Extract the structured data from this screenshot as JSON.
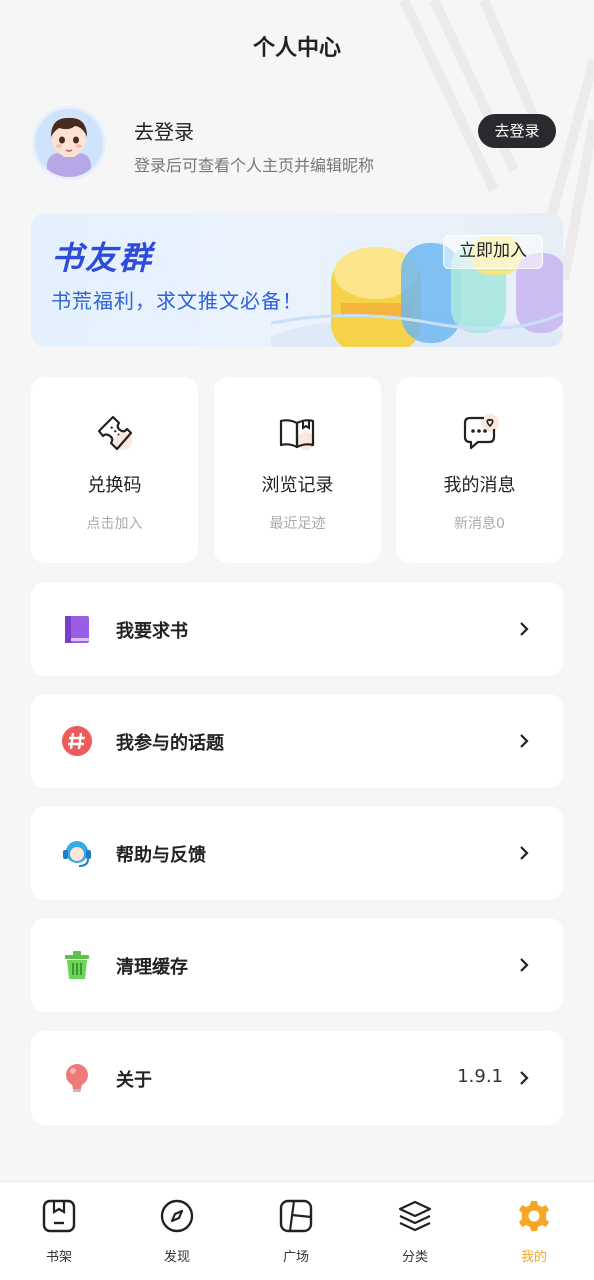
{
  "header": {
    "title": "个人中心"
  },
  "profile": {
    "title": "去登录",
    "subtitle": "登录后可查看个人主页并编辑昵称",
    "button": "去登录"
  },
  "banner": {
    "title": "书友群",
    "subtitle": "书荒福利，求文推文必备！",
    "button": "立即加入"
  },
  "cards": [
    {
      "title": "兑换码",
      "subtitle": "点击加入",
      "icon": "ticket-icon"
    },
    {
      "title": "浏览记录",
      "subtitle": "最近足迹",
      "icon": "book-open-icon"
    },
    {
      "title": "我的消息",
      "subtitle": "新消息0",
      "icon": "message-icon"
    }
  ],
  "menu": [
    {
      "label": "我要求书",
      "icon": "book-icon",
      "value": ""
    },
    {
      "label": "我参与的话题",
      "icon": "hashtag-icon",
      "value": ""
    },
    {
      "label": "帮助与反馈",
      "icon": "headset-icon",
      "value": ""
    },
    {
      "label": "清理缓存",
      "icon": "trash-icon",
      "value": ""
    },
    {
      "label": "关于",
      "icon": "lightbulb-icon",
      "value": "1.9.1"
    }
  ],
  "tabbar": {
    "active": "我的",
    "active_color": "#f5a623",
    "items": [
      {
        "label": "书架",
        "icon": "bookshelf-icon"
      },
      {
        "label": "发现",
        "icon": "compass-icon"
      },
      {
        "label": "广场",
        "icon": "square-icon"
      },
      {
        "label": "分类",
        "icon": "layers-icon"
      },
      {
        "label": "我的",
        "icon": "gear-icon"
      }
    ]
  }
}
